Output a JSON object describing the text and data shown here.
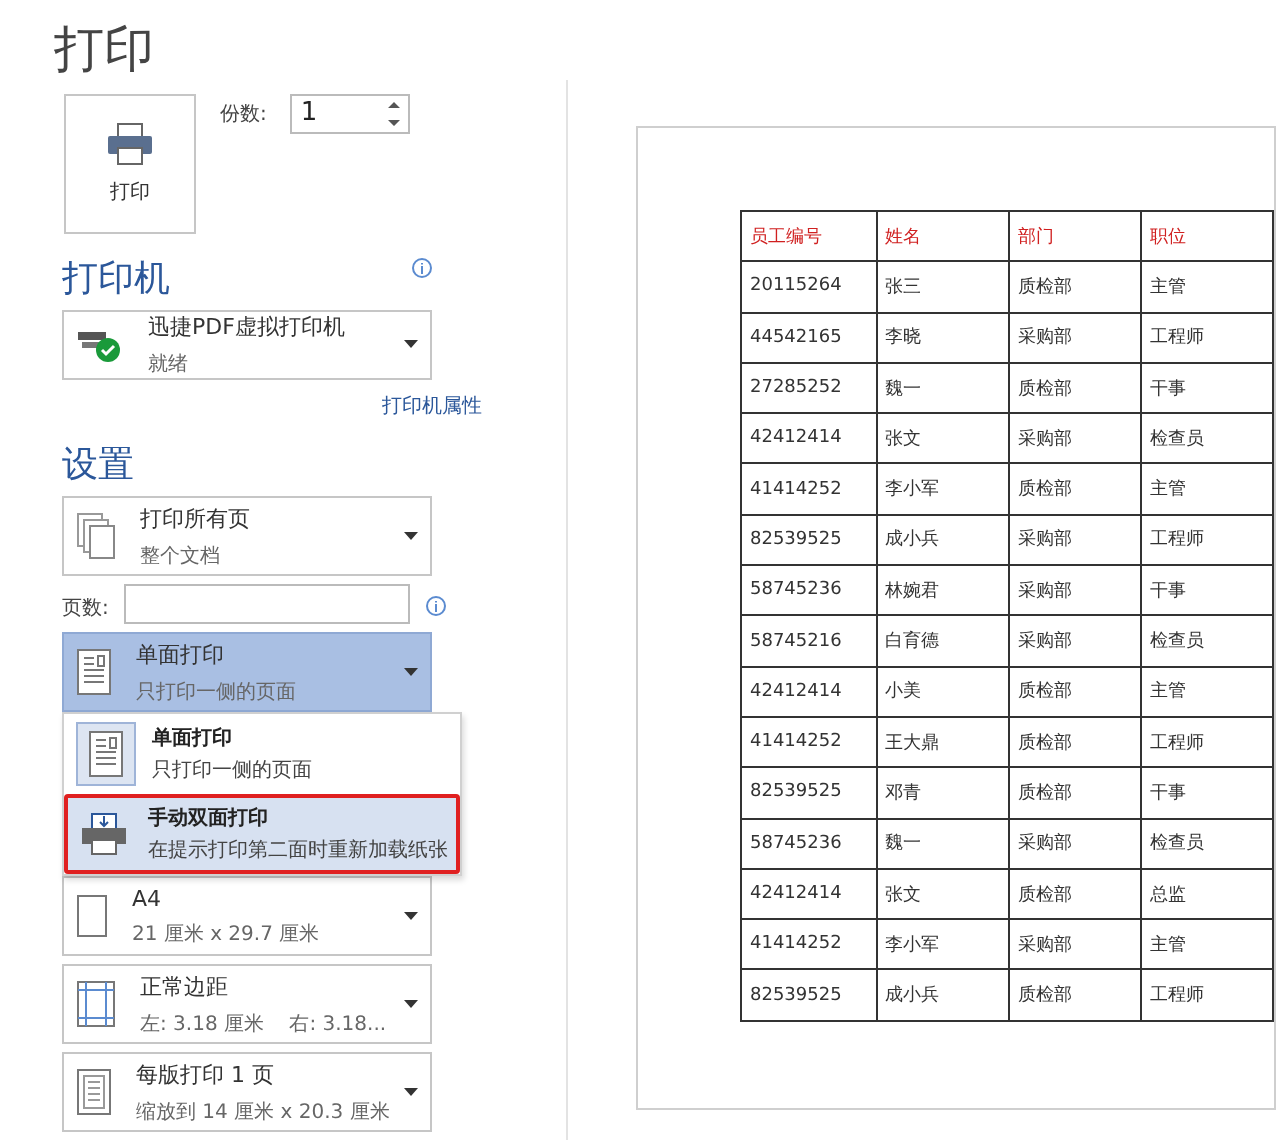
{
  "title": "打印",
  "print_button": {
    "label": "打印"
  },
  "copies": {
    "label": "份数:",
    "value": "1"
  },
  "printer": {
    "heading": "打印机",
    "name": "迅捷PDF虚拟打印机",
    "status": "就绪",
    "properties_link": "打印机属性"
  },
  "settings_heading": "设置",
  "settings": [
    {
      "kind": "pages",
      "title": "打印所有页",
      "subtitle": "整个文档",
      "selected": false
    },
    {
      "kind": "pagesfield",
      "label": "页数:"
    },
    {
      "kind": "sides",
      "title": "单面打印",
      "subtitle": "只打印一侧的页面",
      "selected": true,
      "open": true,
      "menu": [
        {
          "kind": "sides",
          "title": "单面打印",
          "subtitle": "只打印一侧的页面",
          "selected": true,
          "outlined": false
        },
        {
          "kind": "manual",
          "title": "手动双面打印",
          "subtitle": "在提示打印第二面时重新加载纸张",
          "selected": false,
          "outlined": true
        }
      ]
    },
    {
      "kind": "hidden"
    },
    {
      "kind": "paper",
      "title": "A4",
      "subtitle": "21 厘米 x 29.7 厘米",
      "selected": false
    },
    {
      "kind": "margins",
      "title": "正常边距",
      "subtitle": "左: 3.18 厘米    右: 3.18...",
      "selected": false
    },
    {
      "kind": "persheet",
      "title": "每版打印 1 页",
      "subtitle": "缩放到 14 厘米 x 20.3 厘米",
      "selected": false
    }
  ],
  "preview_table": {
    "columns": [
      "员工编号",
      "姓名",
      "部门",
      "职位"
    ],
    "rows": [
      [
        "20115264",
        "张三",
        "质检部",
        "主管"
      ],
      [
        "44542165",
        "李晓",
        "采购部",
        "工程师"
      ],
      [
        "27285252",
        "魏一",
        "质检部",
        "干事"
      ],
      [
        "42412414",
        "张文",
        "采购部",
        "检查员"
      ],
      [
        "41414252",
        "李小军",
        "质检部",
        "主管"
      ],
      [
        "82539525",
        "成小兵",
        "采购部",
        "工程师"
      ],
      [
        "58745236",
        "林婉君",
        "采购部",
        "干事"
      ],
      [
        "58745216",
        "白育德",
        "采购部",
        "检查员"
      ],
      [
        "42412414",
        "小美",
        "质检部",
        "主管"
      ],
      [
        "41414252",
        "王大鼎",
        "质检部",
        "工程师"
      ],
      [
        "82539525",
        "邓青",
        "质检部",
        "干事"
      ],
      [
        "58745236",
        "魏一",
        "采购部",
        "检查员"
      ],
      [
        "42412414",
        "张文",
        "质检部",
        "总监"
      ],
      [
        "41414252",
        "李小军",
        "采购部",
        "主管"
      ],
      [
        "82539525",
        "成小兵",
        "质检部",
        "工程师"
      ]
    ]
  }
}
